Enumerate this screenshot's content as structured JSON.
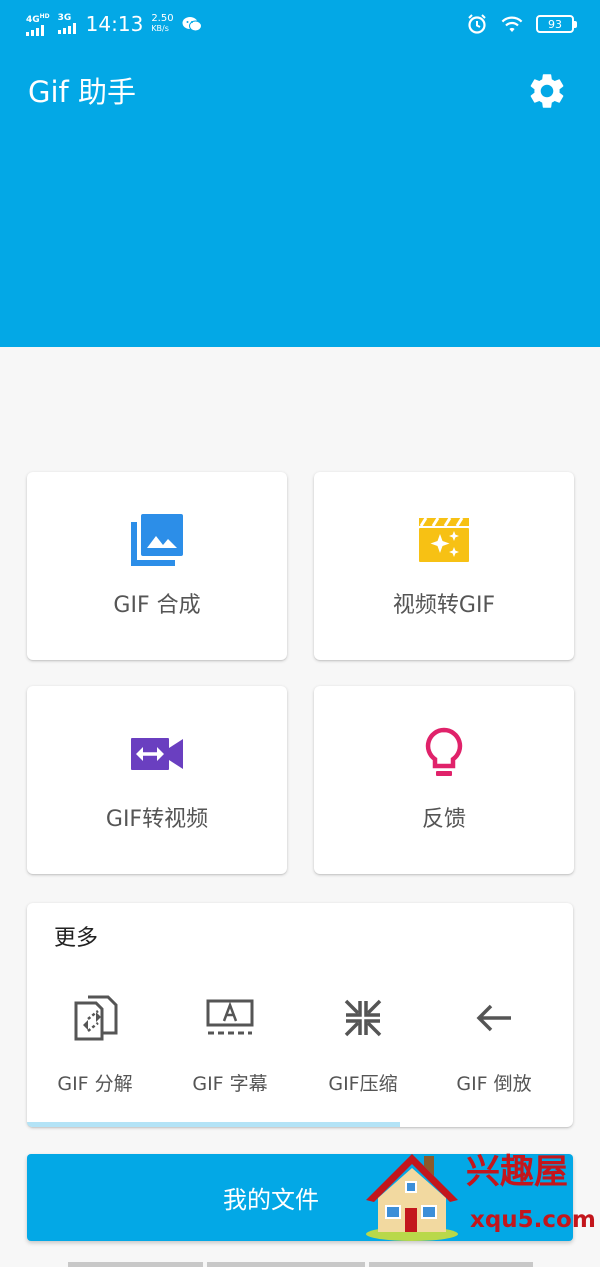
{
  "status_bar": {
    "signal_1_label": "4G",
    "signal_1_sup": "HD",
    "signal_2_label": "3G",
    "time": "14:13",
    "speed_value": "2.50",
    "speed_unit": "KB/s",
    "battery": "93"
  },
  "header": {
    "title": "Gif 助手",
    "settings_icon": "gear-icon",
    "color": "#03a8e6"
  },
  "tiles": [
    {
      "label": "GIF 合成",
      "icon": "image-stack-icon",
      "color": "#2c8ee8"
    },
    {
      "label": "视频转GIF",
      "icon": "movie-sparkle-icon",
      "color": "#f7c114"
    },
    {
      "label": "GIF转视频",
      "icon": "video-swap-icon",
      "color": "#6a3fc0"
    },
    {
      "label": "反馈",
      "icon": "lightbulb-icon",
      "color": "#e0226a"
    }
  ],
  "more": {
    "title": "更多",
    "tools": [
      {
        "label": "GIF 分解",
        "icon": "split-file-icon"
      },
      {
        "label": "GIF 字幕",
        "icon": "subtitle-icon"
      },
      {
        "label": "GIF压缩",
        "icon": "compress-icon"
      },
      {
        "label": "GIF 倒放",
        "icon": "arrow-left-icon"
      }
    ]
  },
  "files_button": {
    "label": "我的文件"
  },
  "watermark": {
    "name": "兴趣屋",
    "url": "xqu5.com"
  }
}
